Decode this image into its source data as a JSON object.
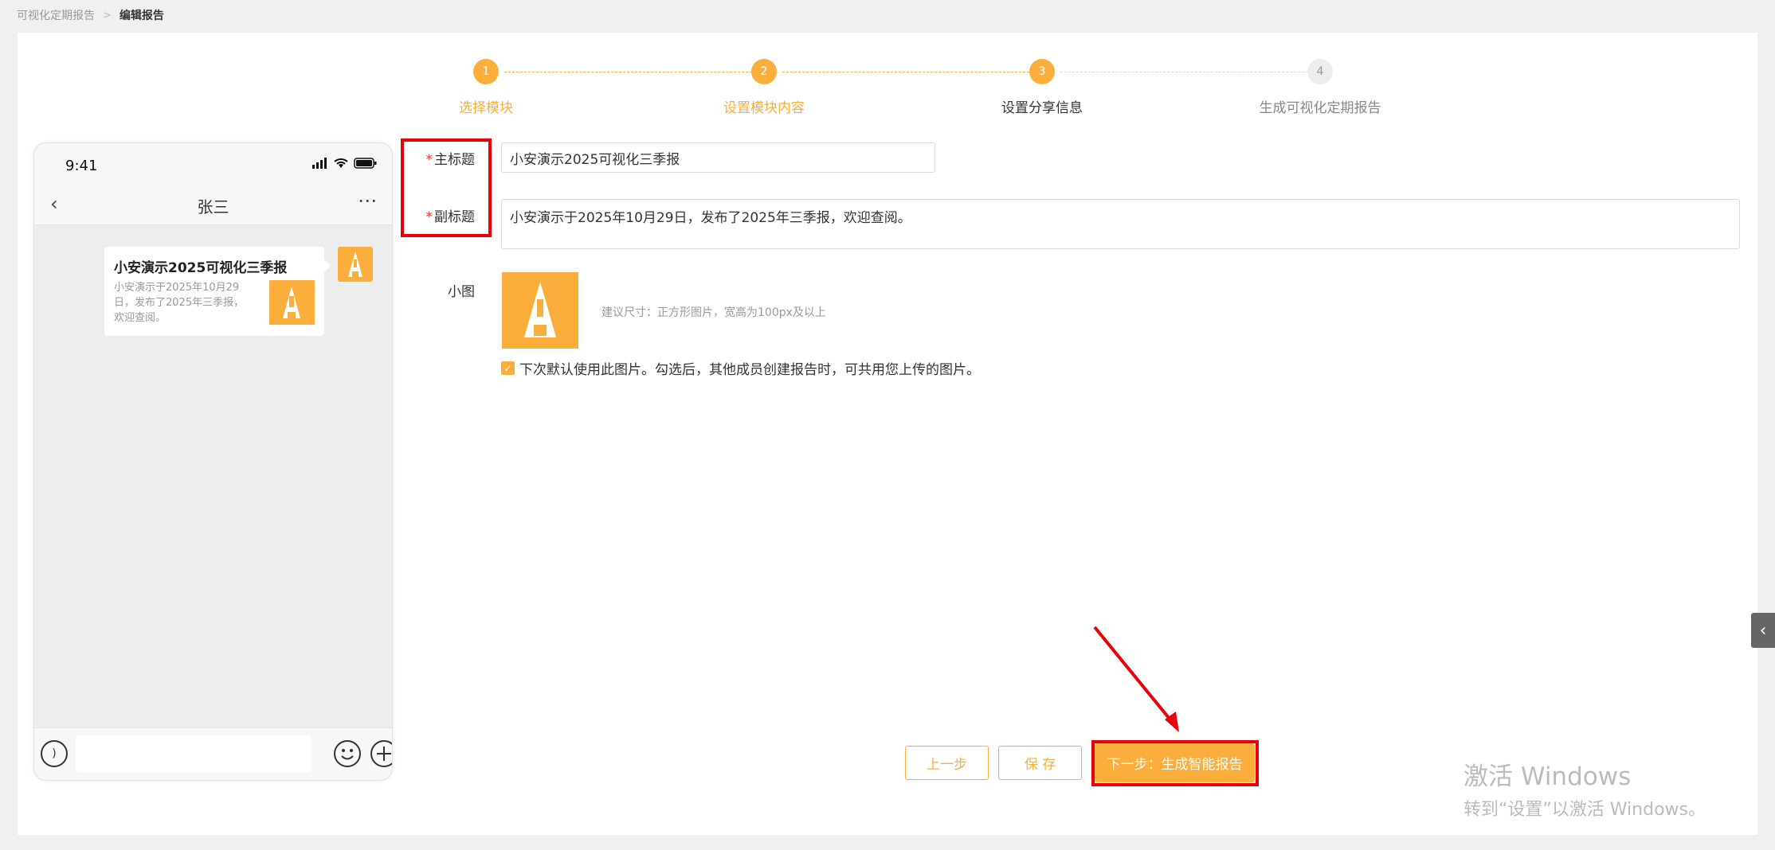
{
  "breadcrumb": {
    "parent": "可视化定期报告",
    "current": "编辑报告"
  },
  "steps": [
    {
      "num": "1",
      "label": "选择模块",
      "state": "done"
    },
    {
      "num": "2",
      "label": "设置模块内容",
      "state": "done"
    },
    {
      "num": "3",
      "label": "设置分享信息",
      "state": "active"
    },
    {
      "num": "4",
      "label": "生成可视化定期报告",
      "state": "todo"
    }
  ],
  "phone": {
    "time": "9:41",
    "chat_title": "张三",
    "message_title": "小安演示2025可视化三季报",
    "message_body": "小安演示于2025年10月29日，发布了2025年三季报，欢迎查阅。"
  },
  "form": {
    "main_title_label": "主标题",
    "main_title_value": "小安演示2025可视化三季报",
    "subtitle_label": "副标题",
    "subtitle_value": "小安演示于2025年10月29日，发布了2025年三季报，欢迎查阅。",
    "thumbnail_label": "小图",
    "thumbnail_hint": "建议尺寸：正方形图片，宽高为100px及以上",
    "default_checkbox_label": "下次默认使用此图片。勾选后，其他成员创建报告时，可共用您上传的图片。",
    "default_checked": true
  },
  "buttons": {
    "prev": "上一步",
    "save": "保 存",
    "next": "下一步：生成智能报告"
  },
  "watermark": {
    "line1": "激活 Windows",
    "line2": "转到“设置”以激活 Windows。"
  },
  "colors": {
    "accent": "#fbae3c",
    "highlight": "#e8000b",
    "required": "#e33333"
  }
}
